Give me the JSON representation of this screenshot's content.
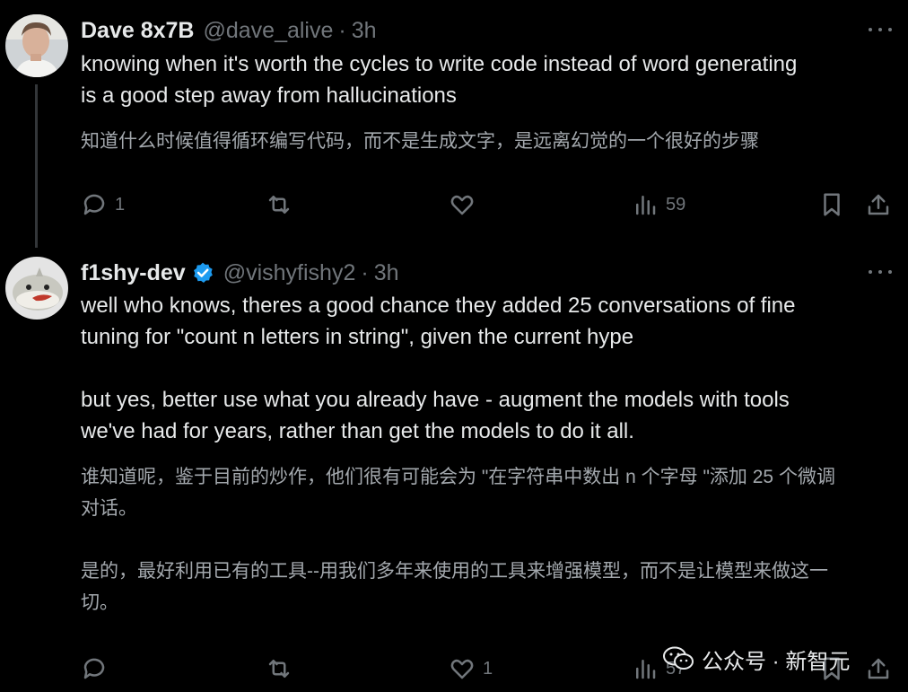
{
  "posts": [
    {
      "display_name": "Dave 8x7B",
      "handle": "@dave_alive",
      "separator": "·",
      "time": "3h",
      "text_lines": [
        "knowing when it's worth the cycles to write code instead of word generating",
        "is a good step away from hallucinations"
      ],
      "translation_lines": [
        "知道什么时候值得循环编写代码，而不是生成文字，是远离幻觉的一个很好的步骤"
      ],
      "actions": {
        "reply_count": "1",
        "retweet_count": "",
        "like_count": "",
        "views_count": "59"
      }
    },
    {
      "display_name": "f1shy-dev",
      "handle": "@vishyfishy2",
      "separator": "·",
      "time": "3h",
      "verified": true,
      "text_lines": [
        "well who knows, theres a good chance they added 25 conversations of fine",
        "tuning for \"count n letters in string\", given the current hype",
        "",
        "but yes, better use what you already have - augment the models with tools",
        "we've had for years, rather than get the models to do it all."
      ],
      "translation_lines": [
        "谁知道呢，鉴于目前的炒作，他们很有可能会为 \"在字符串中数出 n 个字母 \"添加 25 个微调",
        "对话。",
        "",
        "是的，最好利用已有的工具--用我们多年来使用的工具来增强模型，而不是让模型来做这一",
        "切。"
      ],
      "actions": {
        "reply_count": "",
        "retweet_count": "",
        "like_count": "1",
        "views_count": "57"
      }
    }
  ],
  "watermark": {
    "text": "公众号 · 新智元",
    "icon": "wechat-icon"
  },
  "colors": {
    "background": "#000000",
    "text": "#e7e9ea",
    "muted": "#71767b",
    "translation": "#a3a8ad",
    "verified_badge": "#1d9bf0",
    "thread_line": "#333639"
  }
}
